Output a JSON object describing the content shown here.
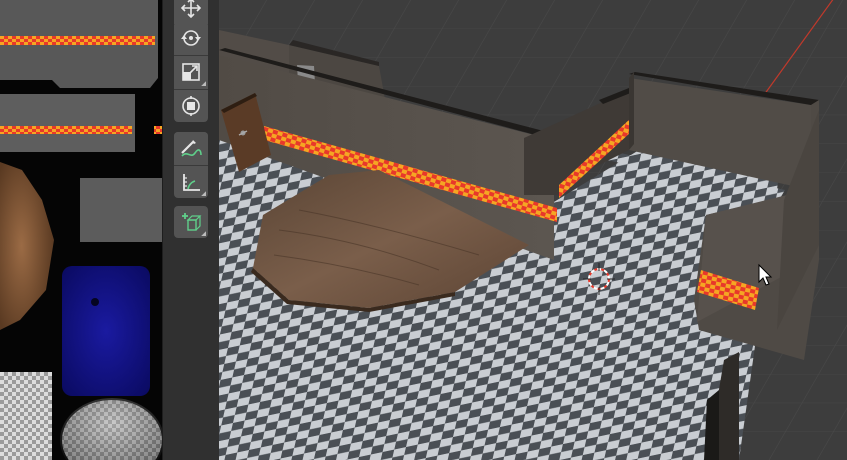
{
  "app": "3D Viewport",
  "toolbar": {
    "tools": [
      {
        "id": "move",
        "icon": "move-icon"
      },
      {
        "id": "rotate",
        "icon": "rotate-icon"
      },
      {
        "id": "scale",
        "icon": "scale-icon"
      },
      {
        "id": "transform",
        "icon": "transform-icon"
      },
      {
        "id": "annotate",
        "icon": "annotate-icon"
      },
      {
        "id": "measure",
        "icon": "measure-icon"
      },
      {
        "id": "add-cube",
        "icon": "add-cube-icon"
      }
    ]
  },
  "colors": {
    "toolbar_bg": "#303030",
    "button_bg": "#545454",
    "grid_bg": "#3d3d3d",
    "wall": "#4f4a45",
    "stripe_red": "#e8382a",
    "stripe_yellow": "#f5a623",
    "floor_light": "#c9cdd2",
    "floor_dark": "#4a4f55",
    "wood": "#6b5040",
    "axis_red": "#c0392b"
  }
}
